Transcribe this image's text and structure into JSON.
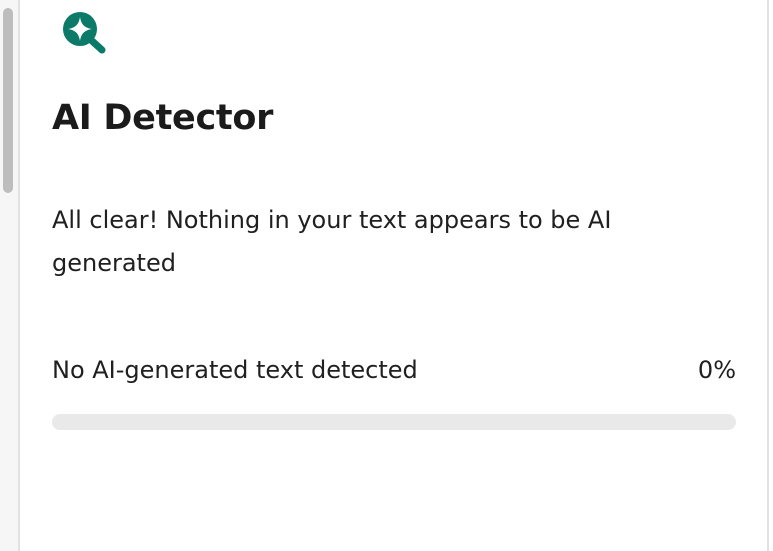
{
  "detector": {
    "title": "AI Detector",
    "icon": "ai-search-icon",
    "description": "All clear! Nothing in your text appears to be AI generated",
    "result": {
      "label": "No AI-generated text detected",
      "percent_text": "0%",
      "fraction": 0
    }
  },
  "colors": {
    "accent": "#0b7a68",
    "track": "#e9e9e9",
    "text": "#1f1f1f"
  }
}
